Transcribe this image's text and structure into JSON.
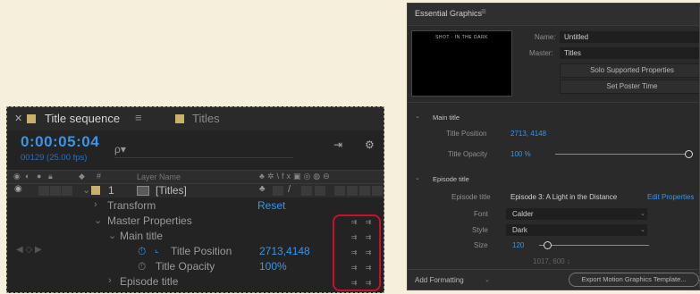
{
  "timeline": {
    "tabs": [
      {
        "label": "Title sequence",
        "color": "#c9b16a",
        "active": true
      },
      {
        "label": "Titles",
        "color": "#c9b16a",
        "active": false
      }
    ],
    "tab_menu": "≡",
    "timecode": "0:00:05:04",
    "frame_info": "00129 (25.00 fps)",
    "search_icon": "ρ▾",
    "header": {
      "layer_name": "Layer Name"
    },
    "layer": {
      "number": "1",
      "name": "[Titles]"
    },
    "rows": {
      "transform": "Transform",
      "reset": "Reset",
      "master_properties": "Master Properties",
      "main_title": "Main title",
      "title_position": "Title Position",
      "title_position_value": "2713,4148",
      "title_opacity": "Title Opacity",
      "title_opacity_value": "100%",
      "episode_title": "Episode title"
    },
    "highlight_color": "#c8102e"
  },
  "essential_graphics": {
    "title": "Essential Graphics",
    "menu": "≡",
    "thumbnail_text": "SHOT · IN THE DARK",
    "name_label": "Name:",
    "name_value": "Untitled",
    "master_label": "Master:",
    "master_value": "Titles",
    "solo_button": "Solo Supported Properties",
    "poster_button": "Set Poster Time",
    "main_title_section": "Main title",
    "title_position_label": "Title Position",
    "title_position_value": "2713, 4148",
    "title_opacity_label": "Title Opacity",
    "title_opacity_value": "100 %",
    "title_opacity_fraction": 1.0,
    "episode_section": "Episode title",
    "episode_title_label": "Episode title",
    "episode_title_value": "Episode 3: A Light in the Distance",
    "edit_properties": "Edit Properties",
    "font_label": "Font",
    "font_value": "Calder",
    "style_label": "Style",
    "style_value": "Dark",
    "size_label": "Size",
    "size_value": "120",
    "size_fraction": 0.08,
    "partial_value": "1017, 600 ↓",
    "add_formatting": "Add Formatting",
    "export_button": "Export Motion Graphics Template..."
  }
}
